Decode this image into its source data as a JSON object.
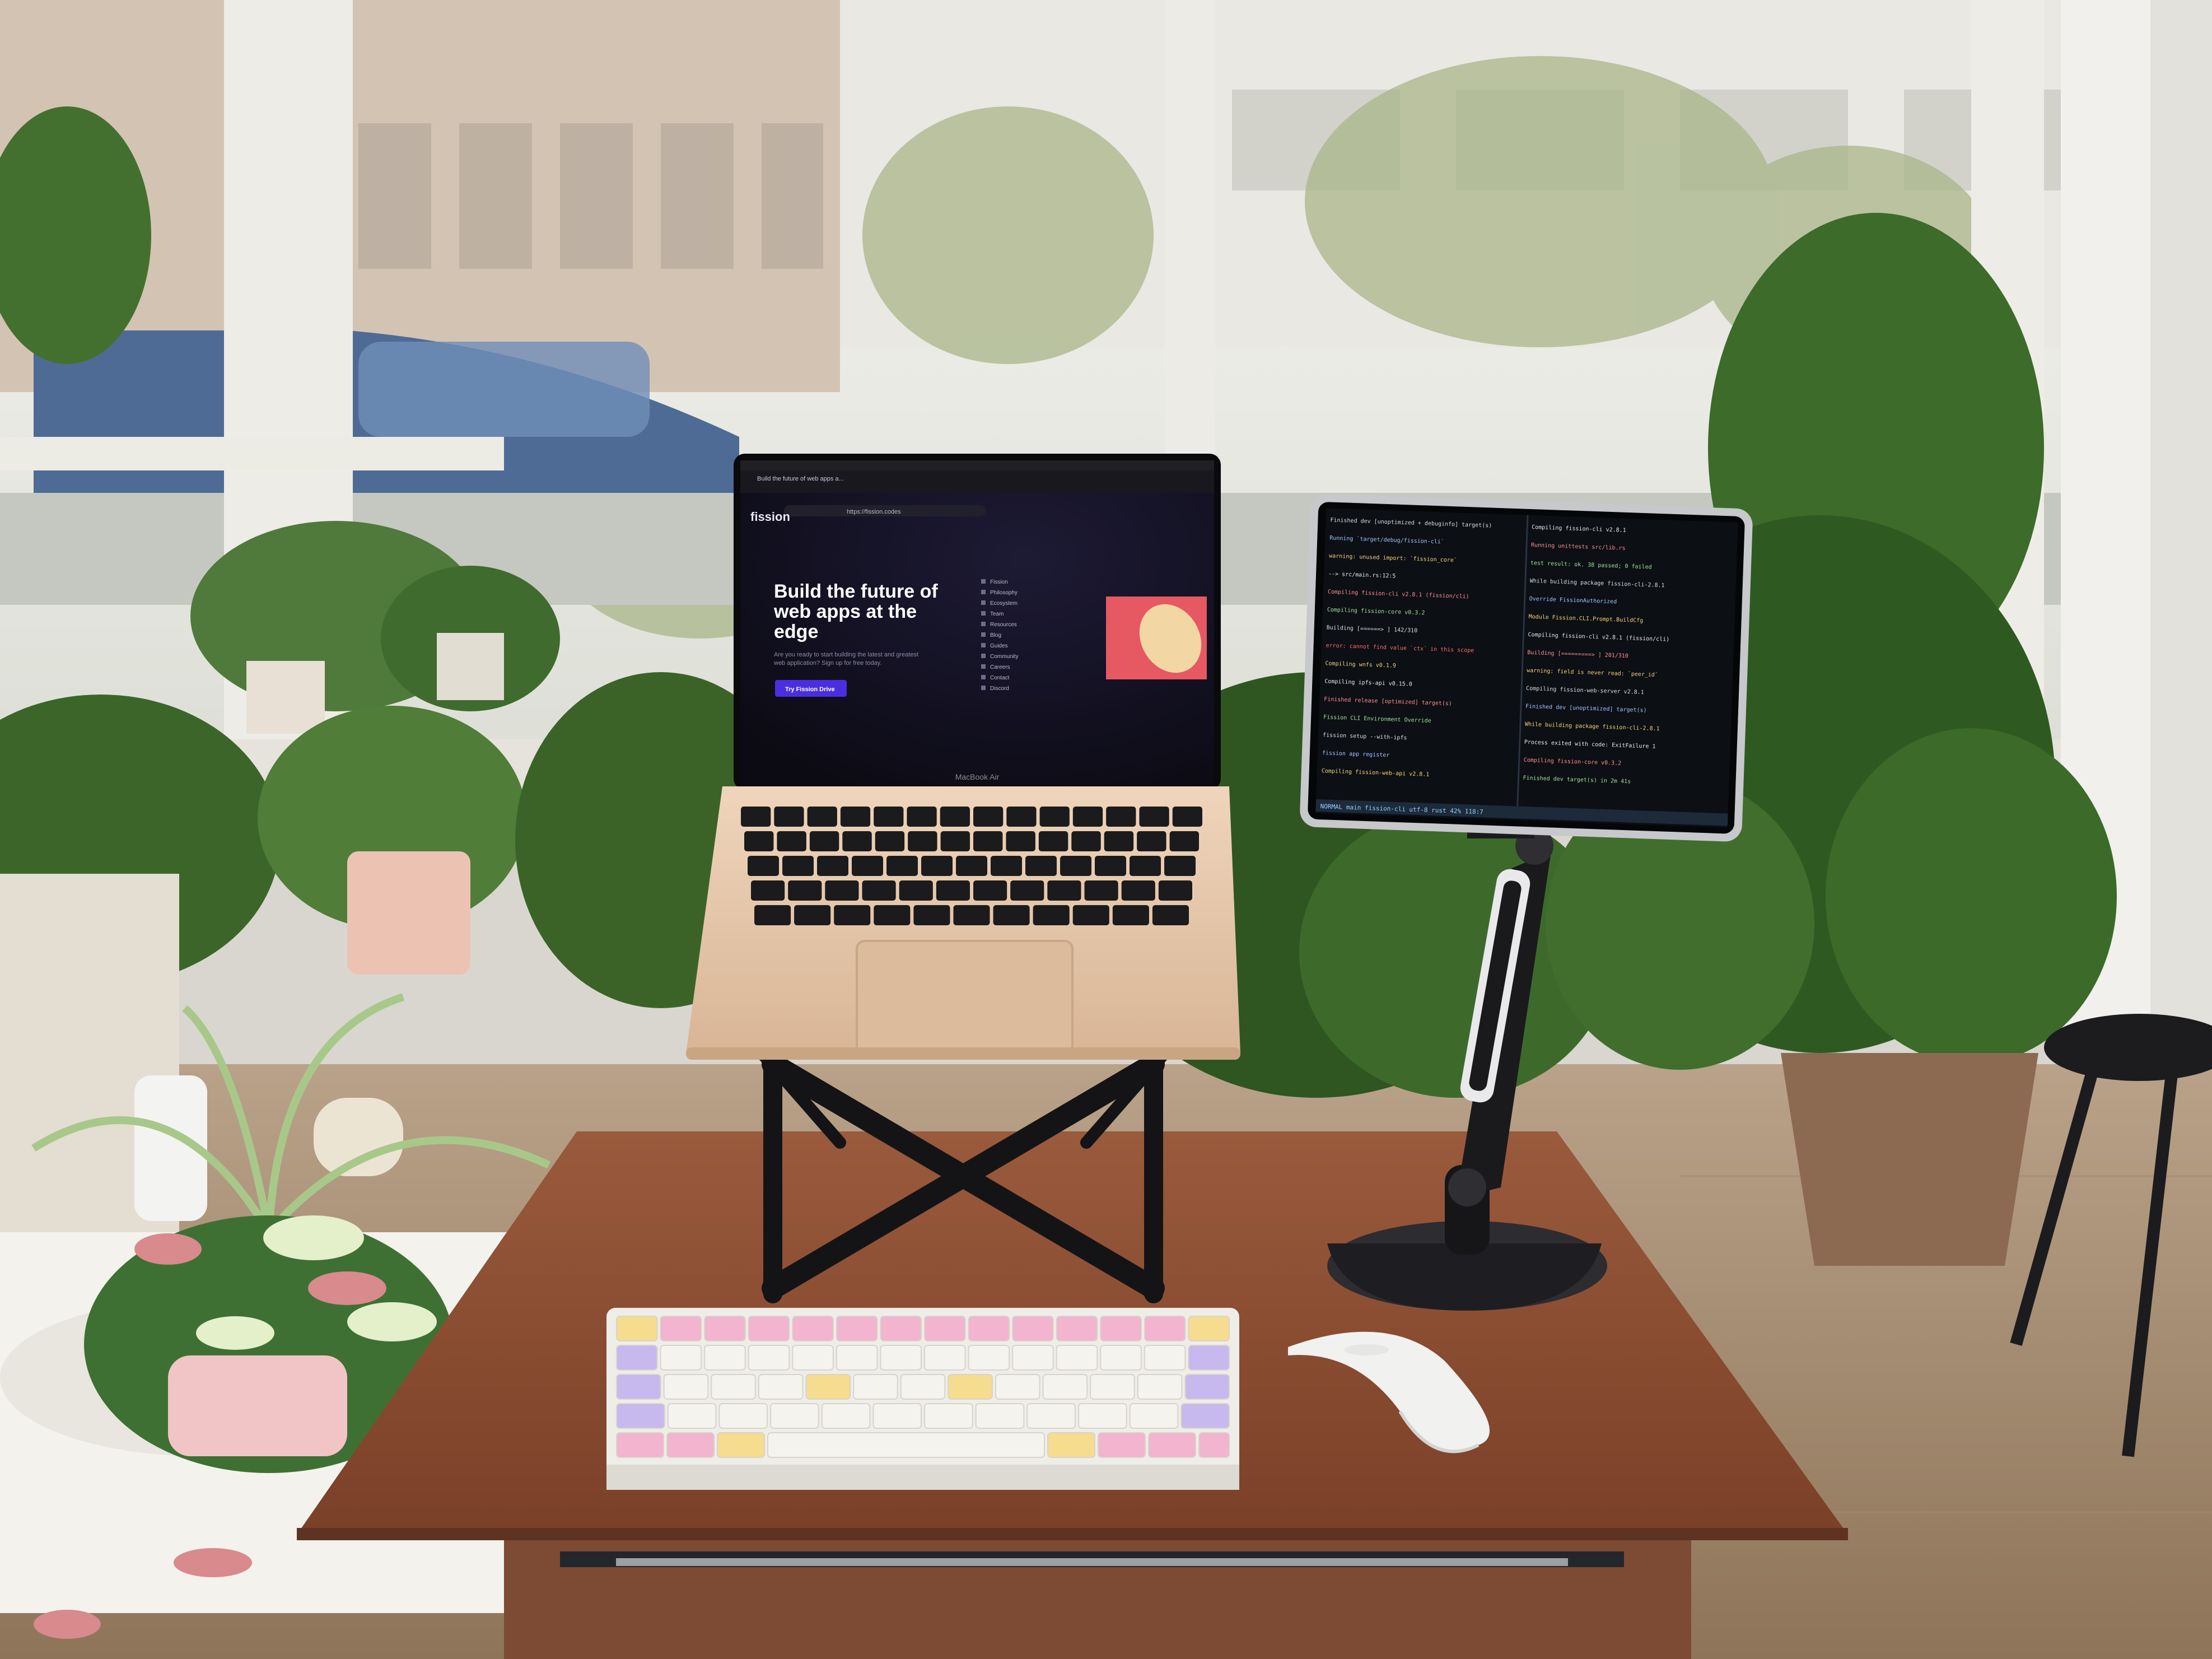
{
  "laptop": {
    "brand_label": "MacBook Air",
    "browser": {
      "tab_title": "Build the future of web apps a...",
      "url": "https://fission.codes"
    },
    "website": {
      "logo_text": "fission",
      "headline_line1": "Build the future of",
      "headline_line2": "web apps at the",
      "headline_line3": "edge",
      "subtext_line1": "Are you ready to start building the latest and greatest",
      "subtext_line2": "web application? Sign up for free today.",
      "cta_button": "Try Fission Drive",
      "sidebar_items": [
        "Fission",
        "Philosophy",
        "Ecosystem",
        "Team",
        "Resources",
        "Blog",
        "Guides",
        "Community",
        "Careers",
        "Contact",
        "Discord"
      ]
    }
  },
  "tablet": {
    "terminal_lines": [
      "Finished dev [unoptimized + debuginfo] target(s)",
      "  Running `target/debug/fission-cli`",
      "warning: unused import: `fission_core`",
      "  --> src/main.rs:12:5",
      "Compiling fission-cli v2.8.1 (fission/cli)",
      "Compiling fission-core v0.3.2",
      "  Building [======>        ] 142/310",
      "error: cannot find value `ctx` in this scope",
      "Compiling wnfs v0.1.9",
      "Compiling ipfs-api v0.15.0",
      "Finished release [optimized] target(s)",
      "Fission CLI Environment Override",
      "  fission setup --with-ipfs",
      "  fission app register",
      "Compiling fission-web-api v2.8.1",
      "Compiling fission-cli v2.8.1",
      "  Running unittests src/lib.rs",
      "test result: ok. 38 passed; 0 failed",
      "While building package fission-cli-2.8.1",
      "Override FissionAuthorized",
      "Module Fission.CLI.Prompt.BuildCfg",
      "Compiling fission-cli v2.8.1 (fission/cli)",
      "  Building [=========>     ] 201/310",
      "warning: field is never read: `peer_id`",
      "Compiling fission-web-server v2.8.1",
      "Finished dev [unoptimized] target(s)",
      "While building package fission-cli-2.8.1",
      "  Process exited with code: ExitFailure 1",
      "Compiling fission-core v0.3.2",
      "Finished dev target(s) in 2m 41s"
    ],
    "status_bar": "NORMAL  main  fission-cli  utf-8  rust  42%  118:7"
  },
  "colors": {
    "laptop_body": "#e5c8ac",
    "laptop_screen_bg": "#111019",
    "cta_button": "#4b2ee0",
    "desk_top": "#8a4e34",
    "window_frame": "#eae9e4",
    "keyboard_lavender": "#c7b8ee",
    "keyboard_pink": "#f2b4cf",
    "keyboard_yellow": "#f5dc8e",
    "keyboard_white": "#f4f3ee",
    "terminal_bg": "#0c0f14"
  },
  "icons": {
    "mouse": "white-arc-mouse-icon",
    "stand": "laptop-x-stand-icon",
    "tablet_arm": "tablet-arm-mount-icon",
    "plants": "houseplant-icon"
  }
}
